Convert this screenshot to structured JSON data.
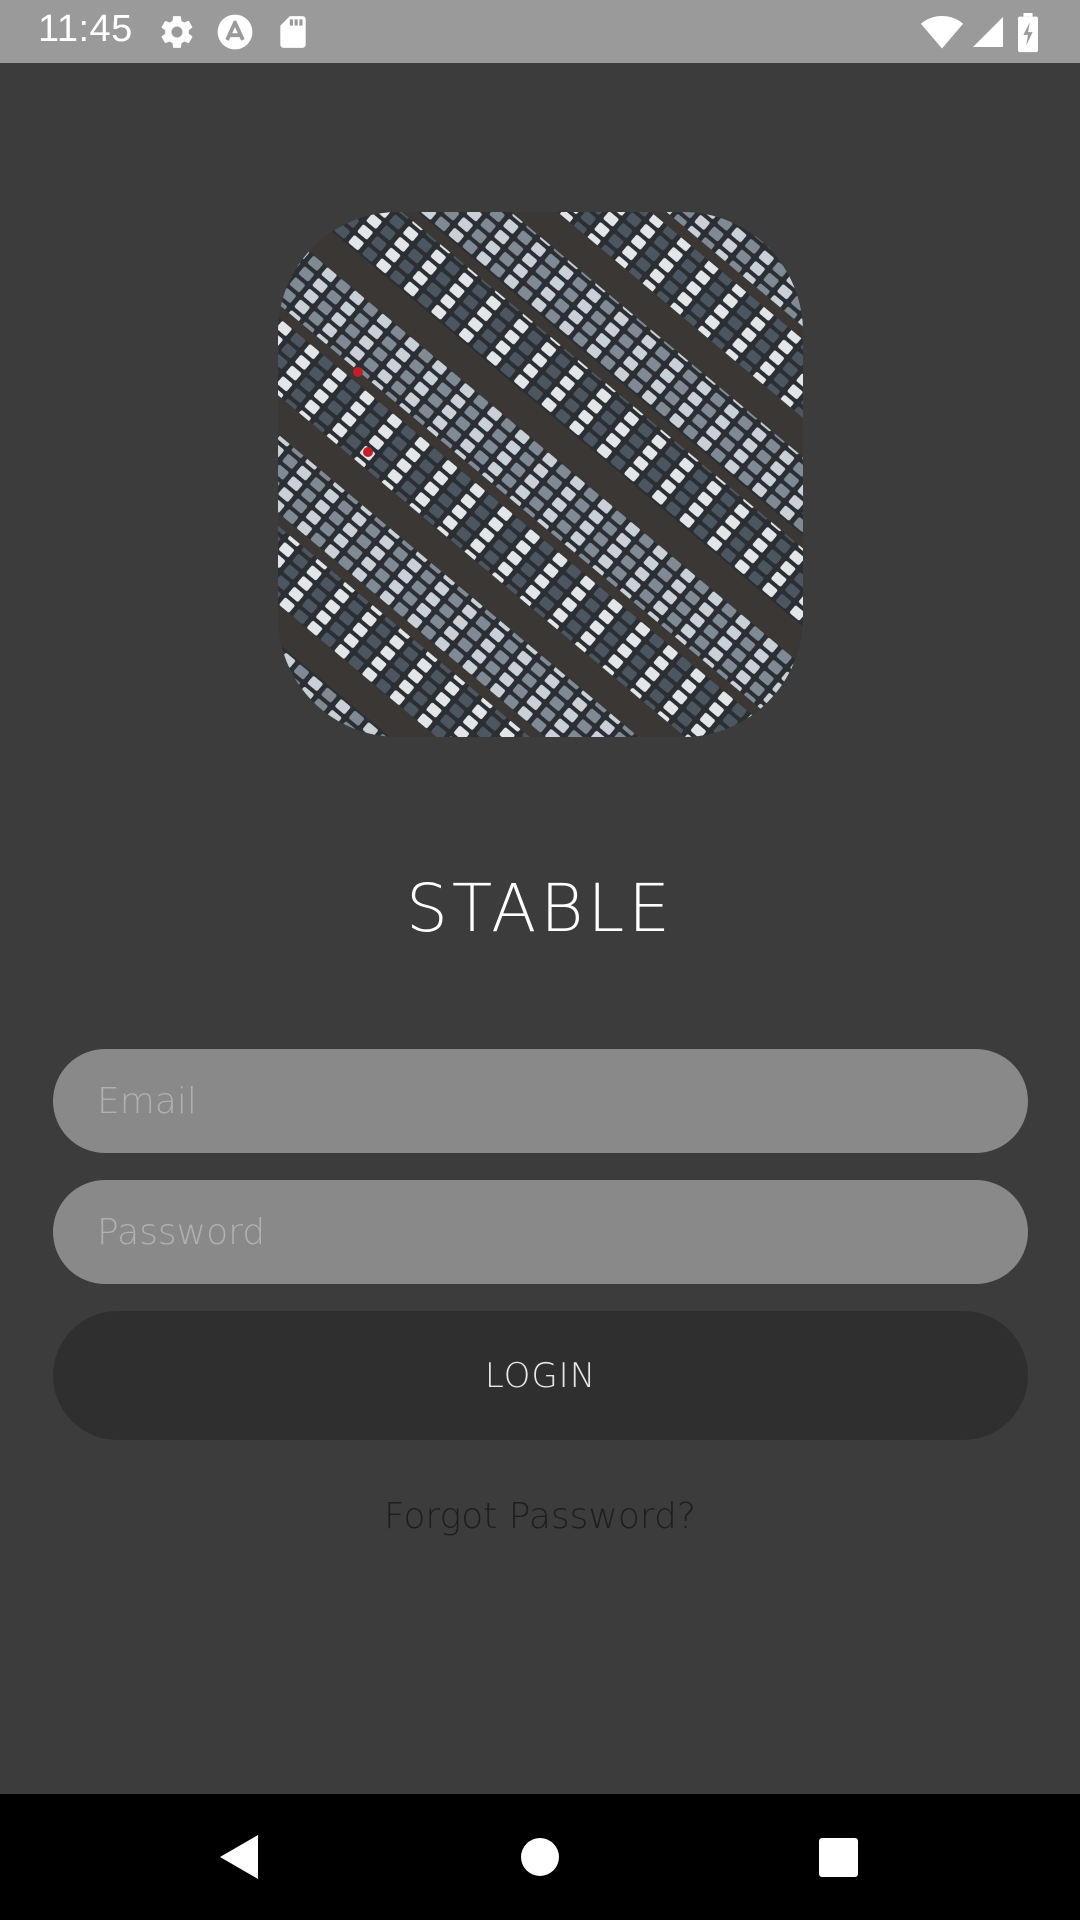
{
  "status_bar": {
    "time": "11:45",
    "left_icons": [
      "settings-icon",
      "autofill-icon",
      "sd-card-icon"
    ],
    "right_icons": [
      "wifi-icon",
      "signal-icon",
      "battery-charging-icon"
    ]
  },
  "app": {
    "title": "STABLE",
    "logo": "parking-lot-photo"
  },
  "form": {
    "email_placeholder": "Email",
    "password_placeholder": "Password",
    "login_label": "LOGIN",
    "forgot_label": "Forgot Password?"
  },
  "nav_bar": {
    "buttons": [
      "back-icon",
      "home-icon",
      "recents-icon"
    ]
  },
  "colors": {
    "background": "#3c3c3c",
    "field": "#898989",
    "button": "#2f2f2f"
  }
}
